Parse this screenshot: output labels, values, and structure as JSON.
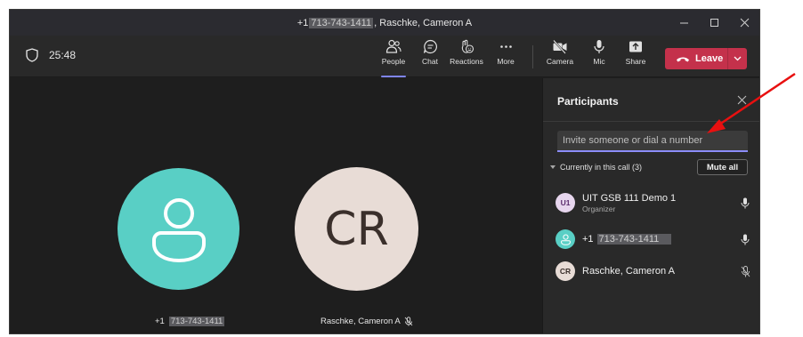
{
  "titlebar": {
    "prefix": "+1",
    "masked_number": "713-743-1411",
    "suffix": ", Raschke, Cameron A"
  },
  "toolbar": {
    "timer": "25:48",
    "people_label": "People",
    "chat_label": "Chat",
    "reactions_label": "Reactions",
    "more_label": "More",
    "camera_label": "Camera",
    "mic_label": "Mic",
    "share_label": "Share",
    "leave_label": "Leave"
  },
  "stage": {
    "tile1_label_prefix": "+1",
    "tile1_label_masked": "713-743-1411",
    "tile2_initials": "CR",
    "tile2_label": "Raschke, Cameron A"
  },
  "panel": {
    "title": "Participants",
    "invite_placeholder": "Invite someone or dial a number",
    "in_call_label": "Currently in this call (3)",
    "mute_all_label": "Mute all",
    "participants": [
      {
        "initials": "U1",
        "name": "UIT GSB 111 Demo 1",
        "role": "Organizer",
        "avatar_bg": "#e7d6ee",
        "avatar_fg": "#5b2d6e",
        "mic": "on"
      },
      {
        "initials": "",
        "name_prefix": "+1",
        "name_masked": "713-743-1411",
        "avatar_bg": "#59cfc5",
        "mic": "on"
      },
      {
        "initials": "CR",
        "name": "Raschke, Cameron A",
        "avatar_bg": "#e8dcd6",
        "avatar_fg": "#3a2f2b",
        "mic": "muted"
      }
    ]
  },
  "colors": {
    "accent": "#7f85f5",
    "leave": "#c4314b",
    "annotation_arrow": "#e81010"
  }
}
